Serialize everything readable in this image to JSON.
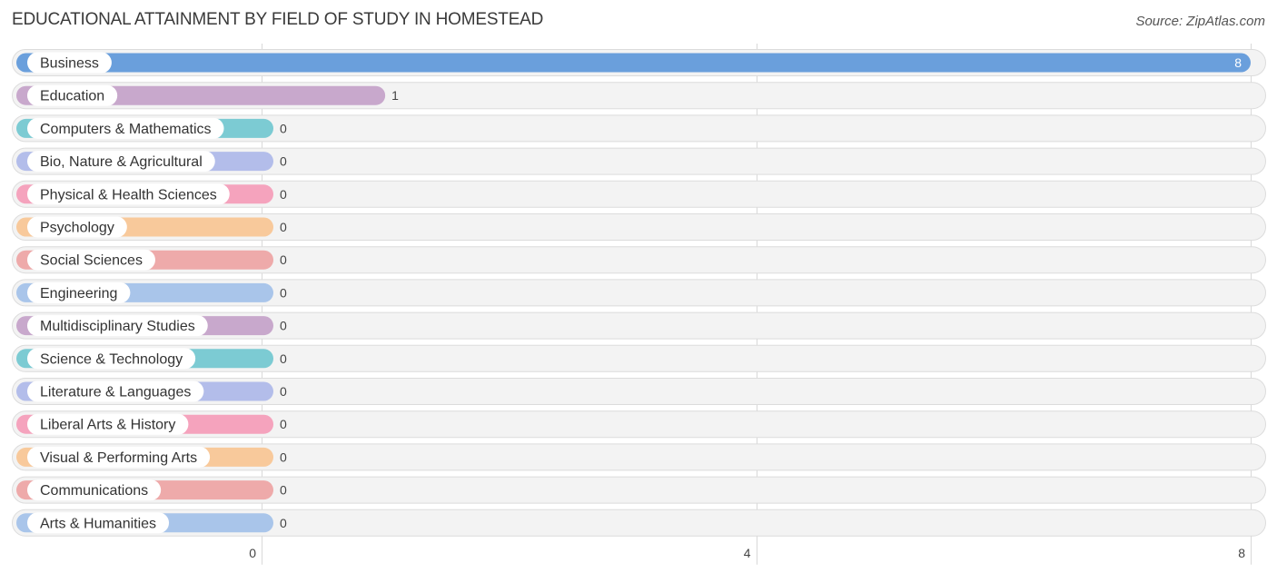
{
  "header": {
    "title": "EDUCATIONAL ATTAINMENT BY FIELD OF STUDY IN HOMESTEAD",
    "source": "Source: ZipAtlas.com"
  },
  "chart_data": {
    "type": "bar",
    "orientation": "horizontal",
    "title": "EDUCATIONAL ATTAINMENT BY FIELD OF STUDY IN HOMESTEAD",
    "xlabel": "",
    "ylabel": "",
    "xlim": [
      0,
      8
    ],
    "x_ticks": [
      0,
      4,
      8
    ],
    "grid": true,
    "legend": "none",
    "categories": [
      "Business",
      "Education",
      "Computers & Mathematics",
      "Bio, Nature & Agricultural",
      "Physical & Health Sciences",
      "Psychology",
      "Social Sciences",
      "Engineering",
      "Multidisciplinary Studies",
      "Science & Technology",
      "Literature & Languages",
      "Liberal Arts & History",
      "Visual & Performing Arts",
      "Communications",
      "Arts & Humanities"
    ],
    "values": [
      8,
      1,
      0,
      0,
      0,
      0,
      0,
      0,
      0,
      0,
      0,
      0,
      0,
      0,
      0
    ],
    "colors": [
      "#6a9fdc",
      "#c8a8cc",
      "#7ccbd3",
      "#b3bdea",
      "#f5a3bd",
      "#f8c99b",
      "#eeaaaa",
      "#a9c5ea",
      "#c8a8cc",
      "#7ccbd3",
      "#b3bdea",
      "#f5a3bd",
      "#f8c99b",
      "#eeaaaa",
      "#a9c5ea"
    ]
  }
}
